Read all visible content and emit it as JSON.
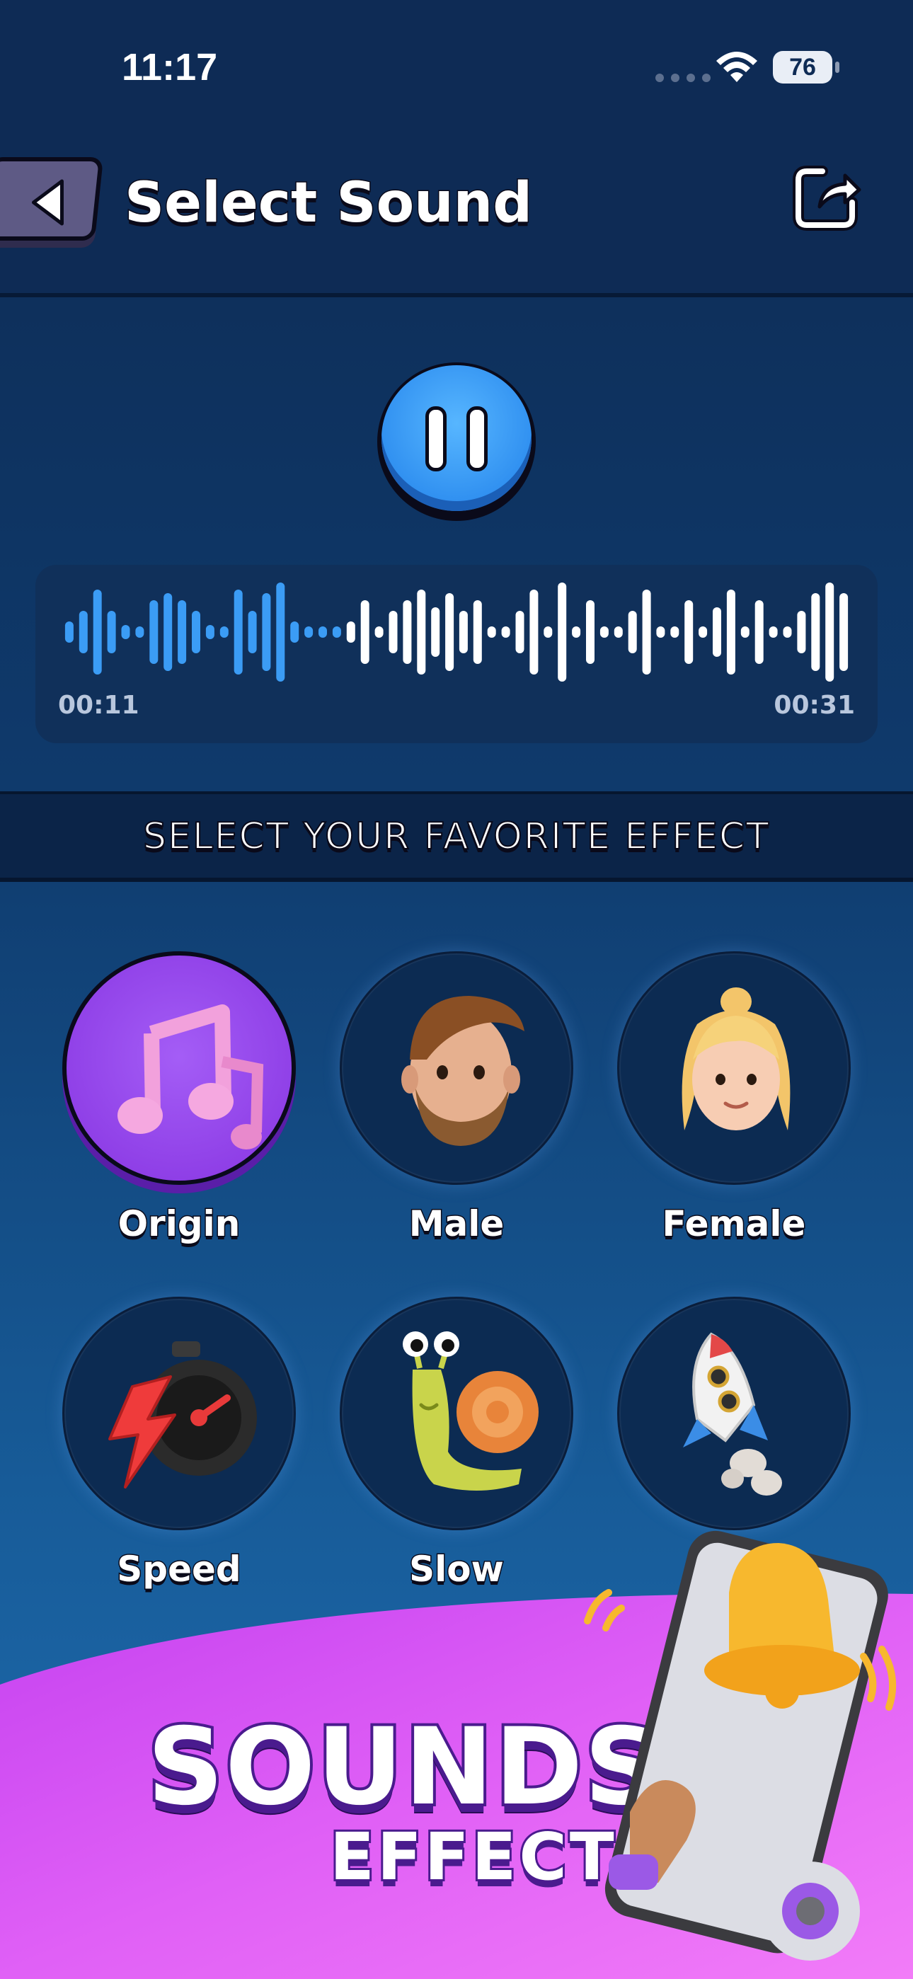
{
  "status_bar": {
    "time": "11:17",
    "battery": "76"
  },
  "header": {
    "title": "Select Sound"
  },
  "player": {
    "current_time": "00:11",
    "total_time": "00:31",
    "progress": 0.35,
    "state": "playing"
  },
  "section": {
    "title": "SELECT YOUR FAVORITE EFFECT"
  },
  "effects": [
    {
      "label": "Origin",
      "icon": "music-notes-icon",
      "selected": true
    },
    {
      "label": "Male",
      "icon": "male-face-icon",
      "selected": false
    },
    {
      "label": "Female",
      "icon": "female-face-icon",
      "selected": false
    },
    {
      "label": "Speed",
      "icon": "stopwatch-bolt-icon",
      "selected": false
    },
    {
      "label": "Slow",
      "icon": "snail-icon",
      "selected": false
    },
    {
      "label": "",
      "icon": "rocket-icon",
      "selected": false
    }
  ],
  "promo": {
    "title": "SOUNDS",
    "subtitle": "EFFECT"
  },
  "colors": {
    "accent": "#3b9cf5",
    "selected": "#9b4ff0",
    "promo": "#e25cf5"
  }
}
